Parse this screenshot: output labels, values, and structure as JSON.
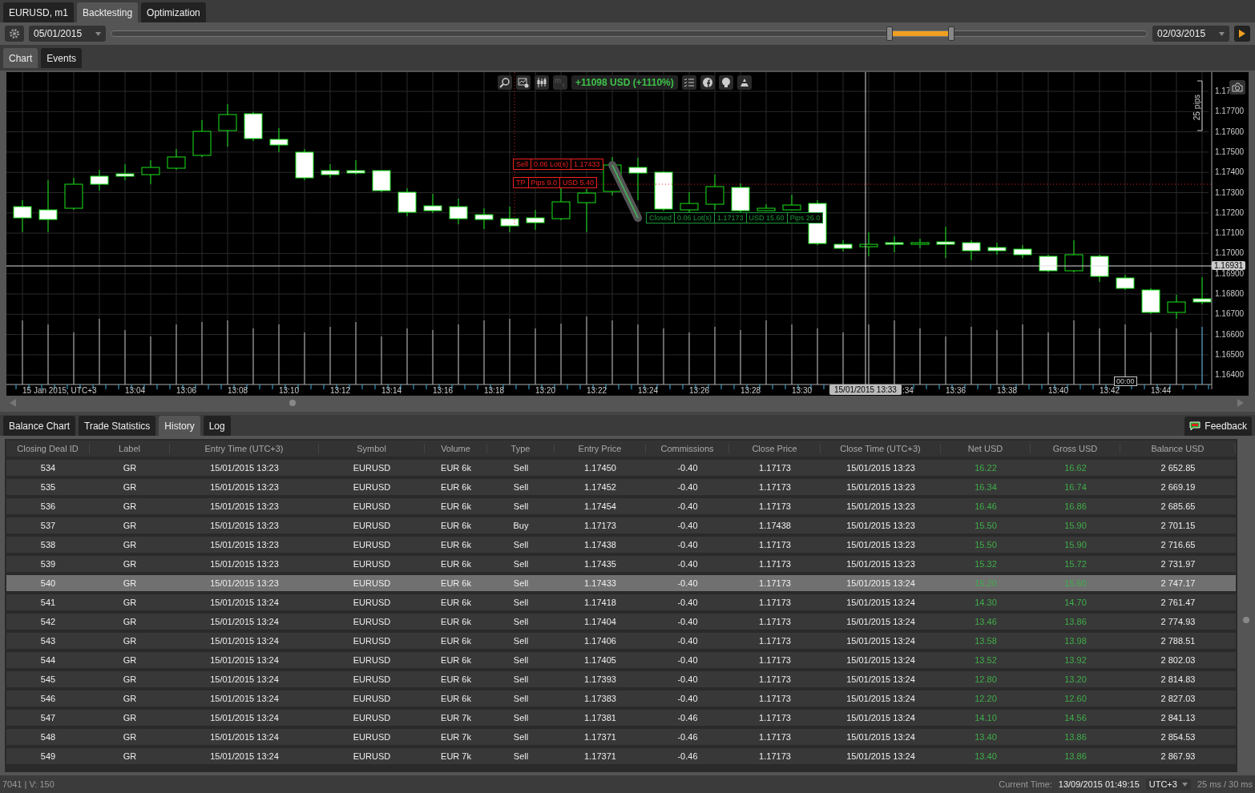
{
  "top_tabs": [
    {
      "label": "EURUSD, m1",
      "selected": false
    },
    {
      "label": "Backtesting",
      "selected": true
    },
    {
      "label": "Optimization",
      "selected": false
    }
  ],
  "toolbar": {
    "start_date": "05/01/2015",
    "end_date": "02/03/2015"
  },
  "chart_tabs": [
    {
      "label": "Chart",
      "selected": true
    },
    {
      "label": "Events",
      "selected": false
    }
  ],
  "chart": {
    "profit": "+11098 USD (+1110%)",
    "pips_bracket": "25 pips",
    "order_label": [
      "Sell",
      "0.06 Lot(s)",
      "1.17433"
    ],
    "tp_label": [
      "TP",
      "Pips 9.0",
      "USD 5.40"
    ],
    "closed_label": [
      "Closed",
      "0.06 Lot(s)",
      "1.17173",
      "USD 15.60",
      "Pips 26.0"
    ],
    "price_labels": [
      "1.17",
      "1.17700",
      "1.17600",
      "1.17500",
      "1.17400",
      "1.17300",
      "1.17200",
      "1.17100",
      "1.17000",
      "1.16900",
      "1.16800",
      "1.16700",
      "1.16600",
      "1.16500",
      "1.16400"
    ],
    "current_price": "1.16931",
    "time_labels": [
      {
        "text": "15 Jan 2015, UTC+3",
        "kind": "date"
      },
      {
        "text": "13:04",
        "kind": "tick"
      },
      {
        "text": "13:06",
        "kind": "tick"
      },
      {
        "text": "13:08",
        "kind": "tick"
      },
      {
        "text": "13:10",
        "kind": "tick"
      },
      {
        "text": "13:12",
        "kind": "tick"
      },
      {
        "text": "13:14",
        "kind": "tick"
      },
      {
        "text": "13:16",
        "kind": "tick"
      },
      {
        "text": "13:18",
        "kind": "tick"
      },
      {
        "text": "13:20",
        "kind": "tick"
      },
      {
        "text": "13:22",
        "kind": "tick"
      },
      {
        "text": "13:24",
        "kind": "tick"
      },
      {
        "text": "13:26",
        "kind": "tick"
      },
      {
        "text": "13:28",
        "kind": "tick"
      },
      {
        "text": "13:30",
        "kind": "tick"
      },
      {
        "text": "15/01/2015 13:33",
        "kind": "badge"
      },
      {
        "text": ":34",
        "kind": "partial"
      },
      {
        "text": "13:36",
        "kind": "tick"
      },
      {
        "text": "13:38",
        "kind": "tick"
      },
      {
        "text": "13:40",
        "kind": "tick"
      },
      {
        "text": "13:42",
        "kind": "tick"
      },
      {
        "text": "13:44",
        "kind": "tick"
      }
    ],
    "hover_time": "00:00"
  },
  "panel_tabs": [
    {
      "label": "Balance Chart",
      "selected": false
    },
    {
      "label": "Trade Statistics",
      "selected": false
    },
    {
      "label": "History",
      "selected": true
    },
    {
      "label": "Log",
      "selected": false
    }
  ],
  "feedback": "Feedback",
  "table": {
    "columns": [
      "Closing Deal ID",
      "Label",
      "Entry Time (UTC+3)",
      "Symbol",
      "Volume",
      "Type",
      "Entry Price",
      "Commissions",
      "Close Price",
      "Close Time (UTC+3)",
      "Net USD",
      "Gross USD",
      "Balance USD"
    ],
    "rows": [
      {
        "selected": false,
        "cells": [
          "534",
          "GR",
          "15/01/2015 13:23",
          "EURUSD",
          "EUR 6k",
          "Sell",
          "1.17450",
          "-0.40",
          "1.17173",
          "15/01/2015 13:23",
          "16.22",
          "16.62",
          "2 652.85"
        ]
      },
      {
        "selected": false,
        "cells": [
          "535",
          "GR",
          "15/01/2015 13:23",
          "EURUSD",
          "EUR 6k",
          "Sell",
          "1.17452",
          "-0.40",
          "1.17173",
          "15/01/2015 13:23",
          "16.34",
          "16.74",
          "2 669.19"
        ]
      },
      {
        "selected": false,
        "cells": [
          "536",
          "GR",
          "15/01/2015 13:23",
          "EURUSD",
          "EUR 6k",
          "Sell",
          "1.17454",
          "-0.40",
          "1.17173",
          "15/01/2015 13:23",
          "16.46",
          "16.86",
          "2 685.65"
        ]
      },
      {
        "selected": false,
        "cells": [
          "537",
          "GR",
          "15/01/2015 13:23",
          "EURUSD",
          "EUR 6k",
          "Buy",
          "1.17173",
          "-0.40",
          "1.17438",
          "15/01/2015 13:23",
          "15.50",
          "15.90",
          "2 701.15"
        ]
      },
      {
        "selected": false,
        "cells": [
          "538",
          "GR",
          "15/01/2015 13:23",
          "EURUSD",
          "EUR 6k",
          "Sell",
          "1.17438",
          "-0.40",
          "1.17173",
          "15/01/2015 13:23",
          "15.50",
          "15.90",
          "2 716.65"
        ]
      },
      {
        "selected": false,
        "cells": [
          "539",
          "GR",
          "15/01/2015 13:23",
          "EURUSD",
          "EUR 6k",
          "Sell",
          "1.17435",
          "-0.40",
          "1.17173",
          "15/01/2015 13:23",
          "15.32",
          "15.72",
          "2 731.97"
        ]
      },
      {
        "selected": true,
        "cells": [
          "540",
          "GR",
          "15/01/2015 13:23",
          "EURUSD",
          "EUR 6k",
          "Sell",
          "1.17433",
          "-0.40",
          "1.17173",
          "15/01/2015 13:24",
          "15.20",
          "15.60",
          "2 747.17"
        ]
      },
      {
        "selected": false,
        "cells": [
          "541",
          "GR",
          "15/01/2015 13:24",
          "EURUSD",
          "EUR 6k",
          "Sell",
          "1.17418",
          "-0.40",
          "1.17173",
          "15/01/2015 13:24",
          "14.30",
          "14.70",
          "2 761.47"
        ]
      },
      {
        "selected": false,
        "cells": [
          "542",
          "GR",
          "15/01/2015 13:24",
          "EURUSD",
          "EUR 6k",
          "Sell",
          "1.17404",
          "-0.40",
          "1.17173",
          "15/01/2015 13:24",
          "13.46",
          "13.86",
          "2 774.93"
        ]
      },
      {
        "selected": false,
        "cells": [
          "543",
          "GR",
          "15/01/2015 13:24",
          "EURUSD",
          "EUR 6k",
          "Sell",
          "1.17406",
          "-0.40",
          "1.17173",
          "15/01/2015 13:24",
          "13.58",
          "13.98",
          "2 788.51"
        ]
      },
      {
        "selected": false,
        "cells": [
          "544",
          "GR",
          "15/01/2015 13:24",
          "EURUSD",
          "EUR 6k",
          "Sell",
          "1.17405",
          "-0.40",
          "1.17173",
          "15/01/2015 13:24",
          "13.52",
          "13.92",
          "2 802.03"
        ]
      },
      {
        "selected": false,
        "cells": [
          "545",
          "GR",
          "15/01/2015 13:24",
          "EURUSD",
          "EUR 6k",
          "Sell",
          "1.17393",
          "-0.40",
          "1.17173",
          "15/01/2015 13:24",
          "12.80",
          "13.20",
          "2 814.83"
        ]
      },
      {
        "selected": false,
        "cells": [
          "546",
          "GR",
          "15/01/2015 13:24",
          "EURUSD",
          "EUR 6k",
          "Sell",
          "1.17383",
          "-0.40",
          "1.17173",
          "15/01/2015 13:24",
          "12.20",
          "12.60",
          "2 827.03"
        ]
      },
      {
        "selected": false,
        "cells": [
          "547",
          "GR",
          "15/01/2015 13:24",
          "EURUSD",
          "EUR 7k",
          "Sell",
          "1.17381",
          "-0.46",
          "1.17173",
          "15/01/2015 13:24",
          "14.10",
          "14.56",
          "2 841.13"
        ]
      },
      {
        "selected": false,
        "cells": [
          "548",
          "GR",
          "15/01/2015 13:24",
          "EURUSD",
          "EUR 7k",
          "Sell",
          "1.17371",
          "-0.46",
          "1.17173",
          "15/01/2015 13:24",
          "13.40",
          "13.86",
          "2 854.53"
        ]
      },
      {
        "selected": false,
        "cells": [
          "549",
          "GR",
          "15/01/2015 13:24",
          "EURUSD",
          "EUR 7k",
          "Sell",
          "1.17371",
          "-0.46",
          "1.17173",
          "15/01/2015 13:24",
          "13.40",
          "13.86",
          "2 867.93"
        ]
      }
    ]
  },
  "status_bar": {
    "info": "7041 | V: 150",
    "current_time_label": "Current Time:",
    "current_time": "13/09/2015 01:49:15",
    "timezone": "UTC+3",
    "latency": "25 ms / 30 ms"
  }
}
